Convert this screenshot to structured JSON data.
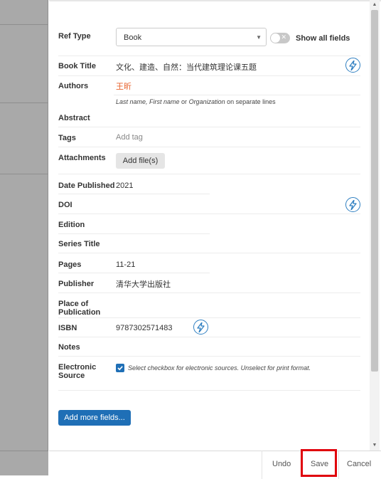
{
  "form": {
    "ref_type": {
      "label": "Ref Type",
      "value": "Book"
    },
    "show_all_fields": {
      "label": "Show all fields"
    },
    "book_title": {
      "label": "Book Title",
      "value": "文化、建造、自然：当代建筑理论课五题"
    },
    "authors": {
      "label": "Authors",
      "value": "王昕",
      "hint_part1": "Last name, First name",
      "hint_part2": " or ",
      "hint_part3": "Organization",
      "hint_part4": " on separate lines"
    },
    "abstract": {
      "label": "Abstract"
    },
    "tags": {
      "label": "Tags",
      "placeholder": "Add tag"
    },
    "attachments": {
      "label": "Attachments",
      "button": "Add file(s)"
    },
    "date_published": {
      "label": "Date Published",
      "value": "2021"
    },
    "doi": {
      "label": "DOI"
    },
    "edition": {
      "label": "Edition"
    },
    "series_title": {
      "label": "Series Title"
    },
    "pages": {
      "label": "Pages",
      "value": "11-21"
    },
    "publisher": {
      "label": "Publisher",
      "value": "清华大学出版社"
    },
    "place_of_publication": {
      "label_line1": "Place of",
      "label_line2": "Publication"
    },
    "isbn": {
      "label": "ISBN",
      "value": "9787302571483"
    },
    "notes": {
      "label": "Notes"
    },
    "electronic_source": {
      "label_line1": "Electronic",
      "label_line2": "Source",
      "checked": true,
      "hint": "Select checkbox for electronic sources. Unselect for print format."
    },
    "add_more_fields": "Add more fields..."
  },
  "footer": {
    "undo": "Undo",
    "save": "Save",
    "cancel": "Cancel"
  },
  "colors": {
    "accent": "#1f6fb6",
    "author_text": "#e8622c",
    "highlight": "#e0000b",
    "bolt": "#2f7fc1"
  },
  "icons": {
    "lookup": "lightning-bolt-icon",
    "dropdown": "caret-down-icon",
    "toggle": "toggle-off-icon",
    "check": "checkmark-icon"
  }
}
